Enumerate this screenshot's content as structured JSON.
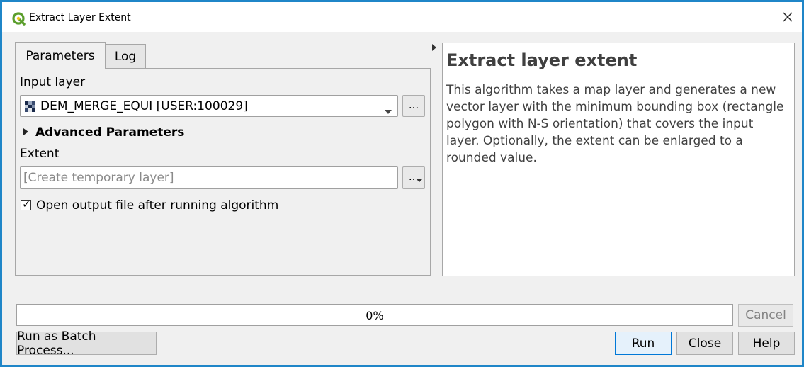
{
  "window": {
    "title": "Extract Layer Extent",
    "accent_color": "#1f86c8"
  },
  "tabs": [
    {
      "label": "Parameters",
      "active": true
    },
    {
      "label": "Log",
      "active": false
    }
  ],
  "params": {
    "input_layer_label": "Input layer",
    "input_layer_value": "DEM_MERGE_EQUI [USER:100029]",
    "browse_button": "...",
    "advanced_label": "Advanced Parameters",
    "extent_label": "Extent",
    "extent_placeholder": "[Create temporary layer]",
    "extent_button": "...",
    "open_output_label": "Open output file after running algorithm",
    "open_output_checked": true
  },
  "help": {
    "title": "Extract layer extent",
    "description": "This algorithm takes a map layer and generates a new vector layer with the minimum bounding box (rectangle polygon with N-S orientation) that covers the input layer. Optionally, the extent can be enlarged to a rounded value."
  },
  "progress": {
    "text": "0%",
    "value": 0
  },
  "buttons": {
    "cancel": "Cancel",
    "batch": "Run as Batch Process...",
    "run": "Run",
    "close": "Close",
    "help": "Help"
  },
  "icons": {
    "app": "qgis-logo-icon",
    "close": "close-icon",
    "layer": "raster-layer-icon",
    "dropdown": "chevron-down-icon",
    "expand": "triangle-right-icon"
  }
}
